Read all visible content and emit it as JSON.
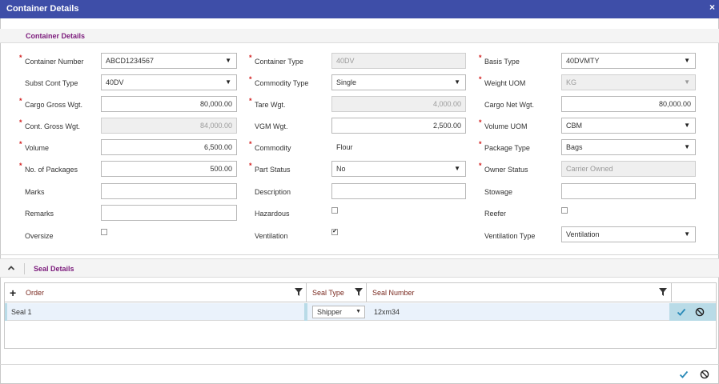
{
  "window": {
    "title": "Container Details",
    "close_glyph": "×"
  },
  "section1": {
    "title": "Container Details"
  },
  "fields": {
    "container_number": {
      "label": "Container Number",
      "value": "ABCD1234567"
    },
    "container_type": {
      "label": "Container Type",
      "value": "40DV"
    },
    "basis_type": {
      "label": "Basis Type",
      "value": "40DVMTY"
    },
    "subst_cont_type": {
      "label": "Subst Cont Type",
      "value": "40DV"
    },
    "commodity_type": {
      "label": "Commodity Type",
      "value": "Single"
    },
    "weight_uom": {
      "label": "Weight UOM",
      "value": "KG"
    },
    "cargo_gross_wgt": {
      "label": "Cargo Gross Wgt.",
      "value": "80,000.00"
    },
    "tare_wgt": {
      "label": "Tare Wgt.",
      "value": "4,000.00"
    },
    "cargo_net_wgt": {
      "label": "Cargo Net Wgt.",
      "value": "80,000.00"
    },
    "cont_gross_wgt": {
      "label": "Cont. Gross Wgt.",
      "value": "84,000.00"
    },
    "vgm_wgt": {
      "label": "VGM Wgt.",
      "value": "2,500.00"
    },
    "volume_uom": {
      "label": "Volume UOM",
      "value": "CBM"
    },
    "volume": {
      "label": "Volume",
      "value": "6,500.00"
    },
    "commodity": {
      "label": "Commodity",
      "value": "Flour"
    },
    "package_type": {
      "label": "Package Type",
      "value": "Bags"
    },
    "no_of_packages": {
      "label": "No. of Packages",
      "value": "500.00"
    },
    "part_status": {
      "label": "Part Status",
      "value": "No"
    },
    "owner_status": {
      "label": "Owner Status",
      "value": "Carrier Owned"
    },
    "marks": {
      "label": "Marks",
      "value": ""
    },
    "description": {
      "label": "Description",
      "value": ""
    },
    "stowage": {
      "label": "Stowage",
      "value": ""
    },
    "remarks": {
      "label": "Remarks",
      "value": ""
    },
    "hazardous": {
      "label": "Hazardous",
      "checked": false
    },
    "reefer": {
      "label": "Reefer",
      "checked": false
    },
    "oversize": {
      "label": "Oversize",
      "checked": false
    },
    "ventilation": {
      "label": "Ventilation",
      "checked": true
    },
    "ventilation_type": {
      "label": "Ventilation Type",
      "value": "Ventilation"
    }
  },
  "glyphs": {
    "required": "*",
    "dropdown": "▼",
    "check": "✔",
    "plus": "+",
    "collapse": "⌃"
  },
  "seal_section": {
    "title": "Seal Details",
    "columns": {
      "order": "Order",
      "seal_type": "Seal Type",
      "seal_number": "Seal Number"
    },
    "rows": [
      {
        "order": "Seal 1",
        "seal_type": "Shipper",
        "seal_number": "12xm34"
      }
    ]
  },
  "icons": [
    "close-icon",
    "collapse-icon",
    "add-icon",
    "filter-icon",
    "confirm-icon",
    "cancel-icon",
    "dropdown-arrow-icon"
  ],
  "colors": {
    "titlebar": "#3e4ea8",
    "section_title": "#7b1a7b",
    "required": "#d21f1f",
    "confirm": "#2a8ab8",
    "action_cell": "#b9dbe7"
  }
}
